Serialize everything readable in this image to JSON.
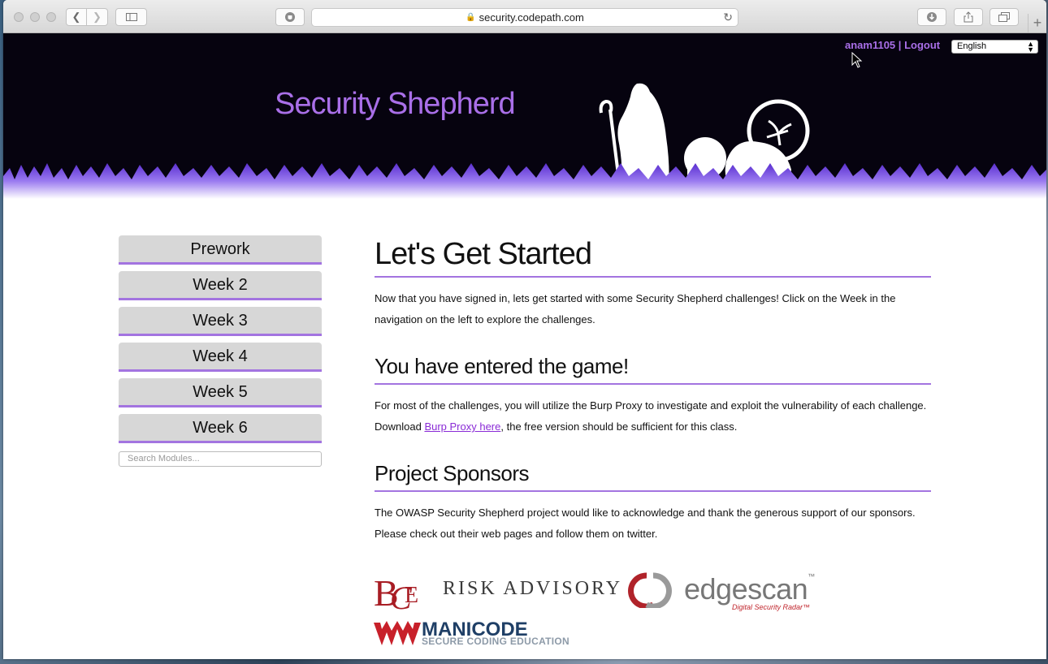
{
  "browser": {
    "url": "security.codepath.com"
  },
  "header": {
    "site_title": "Security Shepherd",
    "username": "anam1105",
    "separator": "|",
    "logout": "Logout",
    "language": "English"
  },
  "sidebar": {
    "items": [
      {
        "label": "Prework"
      },
      {
        "label": "Week 2"
      },
      {
        "label": "Week 3"
      },
      {
        "label": "Week 4"
      },
      {
        "label": "Week 5"
      },
      {
        "label": "Week 6"
      }
    ],
    "search_placeholder": "Search Modules..."
  },
  "main": {
    "title": "Let's Get Started",
    "intro": "Now that you have signed in, lets get started with some Security Shepherd challenges! Click on the Week in the navigation on the left to explore the challenges.",
    "section1_title": "You have entered the game!",
    "section1_text_before": "For most of the challenges, you will utilize the Burp Proxy to investigate and exploit the vulnerability of each challenge. Download ",
    "section1_link": "Burp Proxy here",
    "section1_text_after": ", the free version should be sufficient for this class.",
    "section2_title": "Project Sponsors",
    "section2_text": "The OWASP Security Shepherd project would like to acknowledge and thank the generous support of our sponsors. Please check out their web pages and follow them on twitter."
  },
  "sponsors": {
    "risk_advisory": "RISK ADVISORY",
    "edgescan": "edgescan",
    "edgescan_tm": "™",
    "edgescan_tagline": "Digital Security Radar™",
    "manicode": "MANICODE",
    "manicode_tagline": "SECURE CODING EDUCATION"
  },
  "colors": {
    "accent": "#a374e0",
    "title": "#a96fe8",
    "banner_bg": "#06030f"
  }
}
